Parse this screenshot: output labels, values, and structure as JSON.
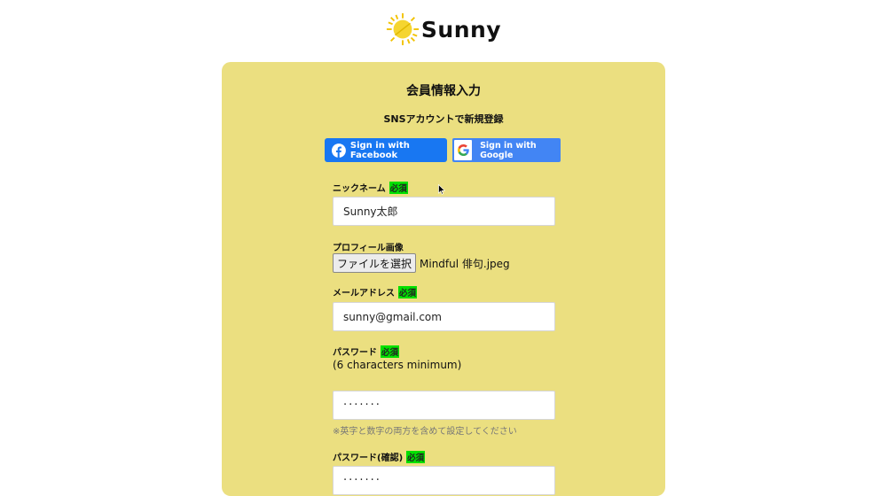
{
  "brand": {
    "name": "Sunny",
    "logo_icon": "sun-icon"
  },
  "card": {
    "title": "会員情報入力",
    "sns_title": "SNSアカウントで新規登録",
    "facebook_button": "Sign in with Facebook",
    "google_button": "Sign in with Google"
  },
  "form": {
    "required_badge": "必須",
    "nickname": {
      "label": "ニックネーム",
      "value": "Sunny太郎"
    },
    "profile_image": {
      "label": "プロフィール画像",
      "button": "ファイルを選択",
      "file_name": "Mindful 俳句.jpeg"
    },
    "email": {
      "label": "メールアドレス",
      "value": "sunny@gmail.com"
    },
    "password": {
      "label": "パスワード",
      "note": "(6 characters minimum)",
      "value": "·······",
      "hint": "※英字と数字の両方を含めて設定してください"
    },
    "password_confirm": {
      "label": "パスワード(確認)",
      "value": "·······"
    }
  },
  "colors": {
    "card_bg": "#ebdf80",
    "facebook": "#1877f2",
    "google": "#4285f4",
    "required": "#00e000"
  }
}
